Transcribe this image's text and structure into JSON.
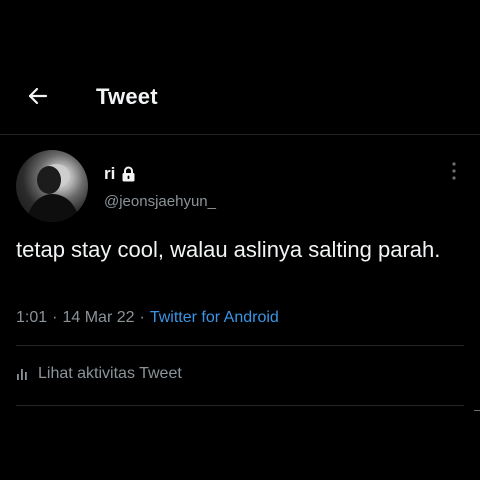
{
  "header": {
    "title": "Tweet",
    "back_icon": "arrow-left-icon"
  },
  "tweet": {
    "author": {
      "display_name": "ri",
      "handle": "@jeonsjaehyun_",
      "protected_icon": "lock-icon"
    },
    "more_icon": "more-vertical-icon",
    "text": "tetap stay cool, walau aslinya salting parah.",
    "time": "1:01",
    "date": "14 Mar 22",
    "separator": "·",
    "source": "Twitter for Android",
    "activity": {
      "icon": "bar-chart-icon",
      "label": "Lihat aktivitas Tweet"
    }
  },
  "colors": {
    "background": "#000000",
    "text_primary": "#f1f3f4",
    "text_secondary": "#8b9399",
    "link": "#3a95e6",
    "divider": "#23272a"
  }
}
